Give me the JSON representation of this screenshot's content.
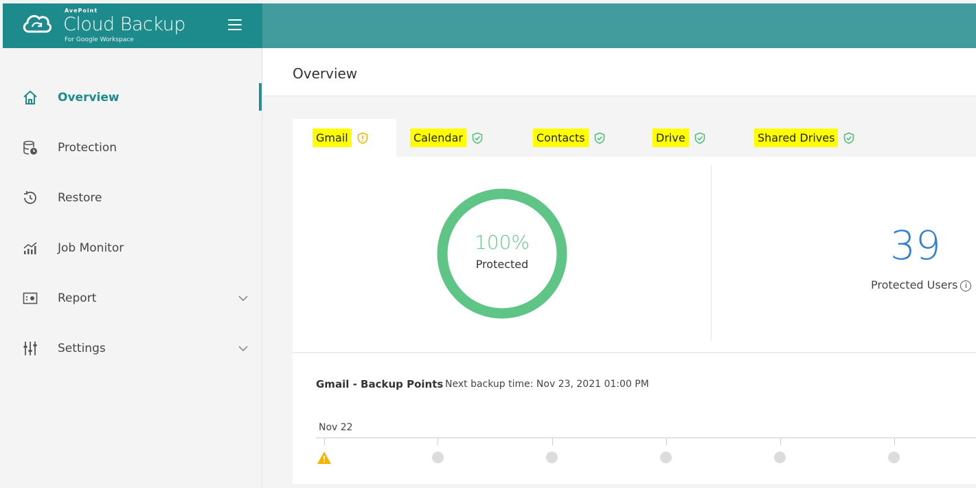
{
  "brand": {
    "company": "AvePoint",
    "product": "Cloud Backup",
    "subtitle": "For Google Workspace",
    "colors": {
      "primary": "#1d8b8b",
      "bar": "#429b9d"
    }
  },
  "sidebar": {
    "items": [
      {
        "label": "Overview",
        "icon": "home-icon",
        "active": true
      },
      {
        "label": "Protection",
        "icon": "database-clock-icon"
      },
      {
        "label": "Restore",
        "icon": "history-icon"
      },
      {
        "label": "Job Monitor",
        "icon": "bar-chart-icon"
      },
      {
        "label": "Report",
        "icon": "report-icon",
        "expandable": true
      },
      {
        "label": "Settings",
        "icon": "sliders-icon",
        "expandable": true
      }
    ]
  },
  "page": {
    "title": "Overview"
  },
  "tabs": [
    {
      "label": "Gmail",
      "status": "warning",
      "status_color": "#f5b400",
      "active": true
    },
    {
      "label": "Calendar",
      "status": "ok",
      "status_color": "#4fbf7a"
    },
    {
      "label": "Contacts",
      "status": "ok",
      "status_color": "#4fbf7a"
    },
    {
      "label": "Drive",
      "status": "ok",
      "status_color": "#4fbf7a"
    },
    {
      "label": "Shared Drives",
      "status": "ok",
      "status_color": "#4fbf7a"
    }
  ],
  "stats": {
    "protected_pct": 100,
    "protected_pct_text": "100%",
    "protected_label": "Protected",
    "ring_color": "#5ec587",
    "users_count": "39",
    "users_label": "Protected Users"
  },
  "backup": {
    "title": "Gmail - Backup Points",
    "next_label": "Next backup time: Nov 23, 2021 01:00 PM",
    "date_label": "Nov 22"
  }
}
